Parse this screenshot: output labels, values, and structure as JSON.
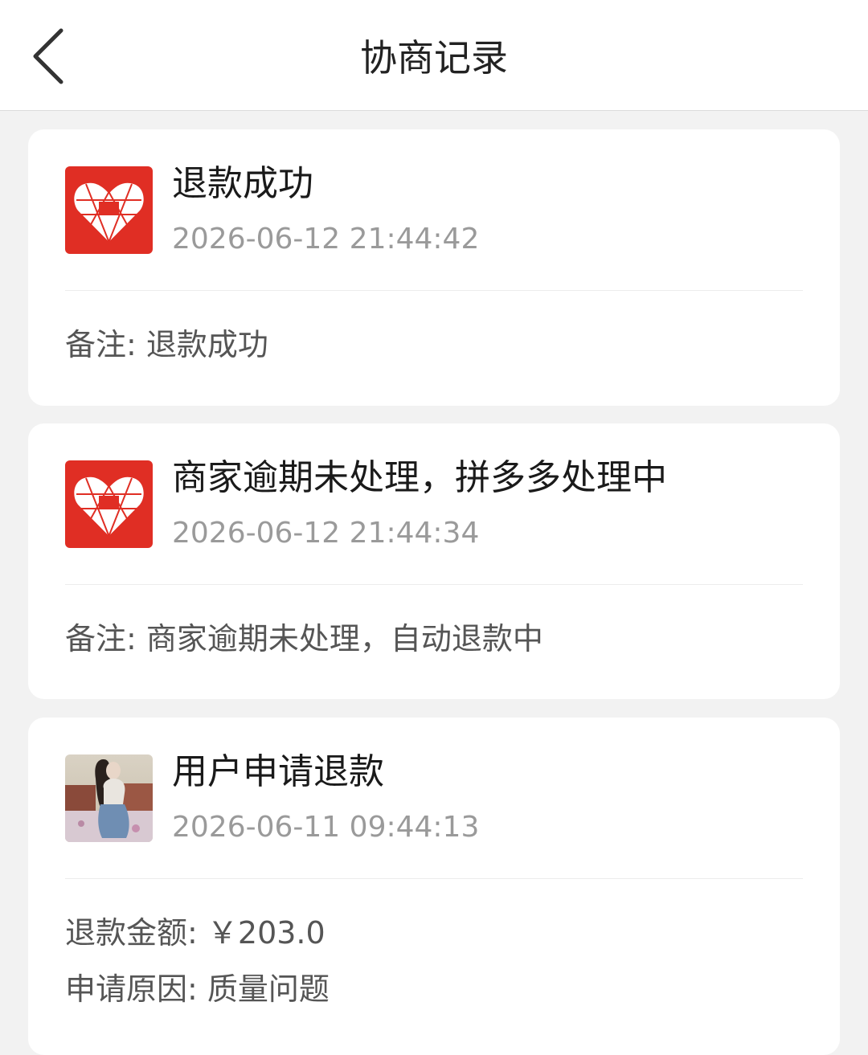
{
  "header": {
    "title": "协商记录",
    "back_icon": "chevron-left-icon"
  },
  "records": [
    {
      "avatar": "pinduoduo-logo",
      "title": "退款成功",
      "time": "2026-06-12 21:44:42",
      "details": [
        {
          "label": "备注",
          "value": "退款成功"
        }
      ]
    },
    {
      "avatar": "pinduoduo-logo",
      "title": "商家逾期未处理，拼多多处理中",
      "time": "2026-06-12 21:44:34",
      "details": [
        {
          "label": "备注",
          "value": "商家逾期未处理，自动退款中"
        }
      ]
    },
    {
      "avatar": "user-photo",
      "title": "用户申请退款",
      "time": "2026-06-11 09:44:13",
      "details": [
        {
          "label": "退款金额",
          "value": "￥203.0"
        },
        {
          "label": "申请原因",
          "value": "质量问题"
        }
      ]
    }
  ],
  "colors": {
    "brand_red": "#e02e24",
    "background": "#f2f2f2",
    "card": "#ffffff",
    "title_text": "#1a1a1a",
    "time_text": "#9a9a9a",
    "detail_text": "#555555"
  }
}
